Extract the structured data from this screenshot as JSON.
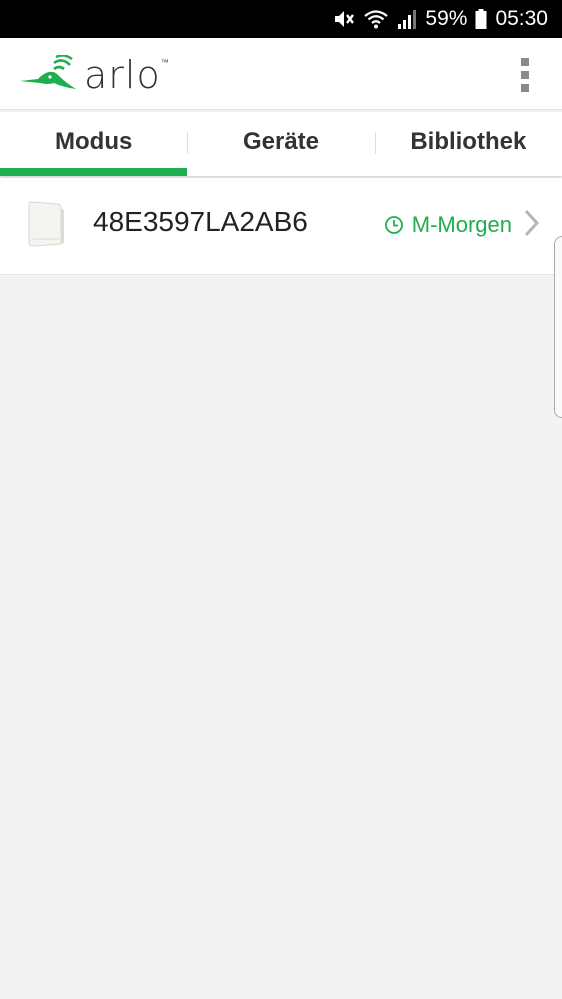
{
  "status_bar": {
    "battery_percent": "59%",
    "time": "05:30",
    "icons": [
      "mute-icon",
      "wifi-icon",
      "signal-icon",
      "battery-icon"
    ]
  },
  "app": {
    "logo_text": "arlo",
    "logo_tm": "™",
    "accent_color": "#1fae4f"
  },
  "tabs": [
    {
      "label": "Modus",
      "active": true
    },
    {
      "label": "Geräte",
      "active": false
    },
    {
      "label": "Bibliothek",
      "active": false
    }
  ],
  "devices": [
    {
      "name": "48E3597LA2AB6",
      "mode": "M-Morgen",
      "mode_icon": "clock-icon"
    }
  ]
}
